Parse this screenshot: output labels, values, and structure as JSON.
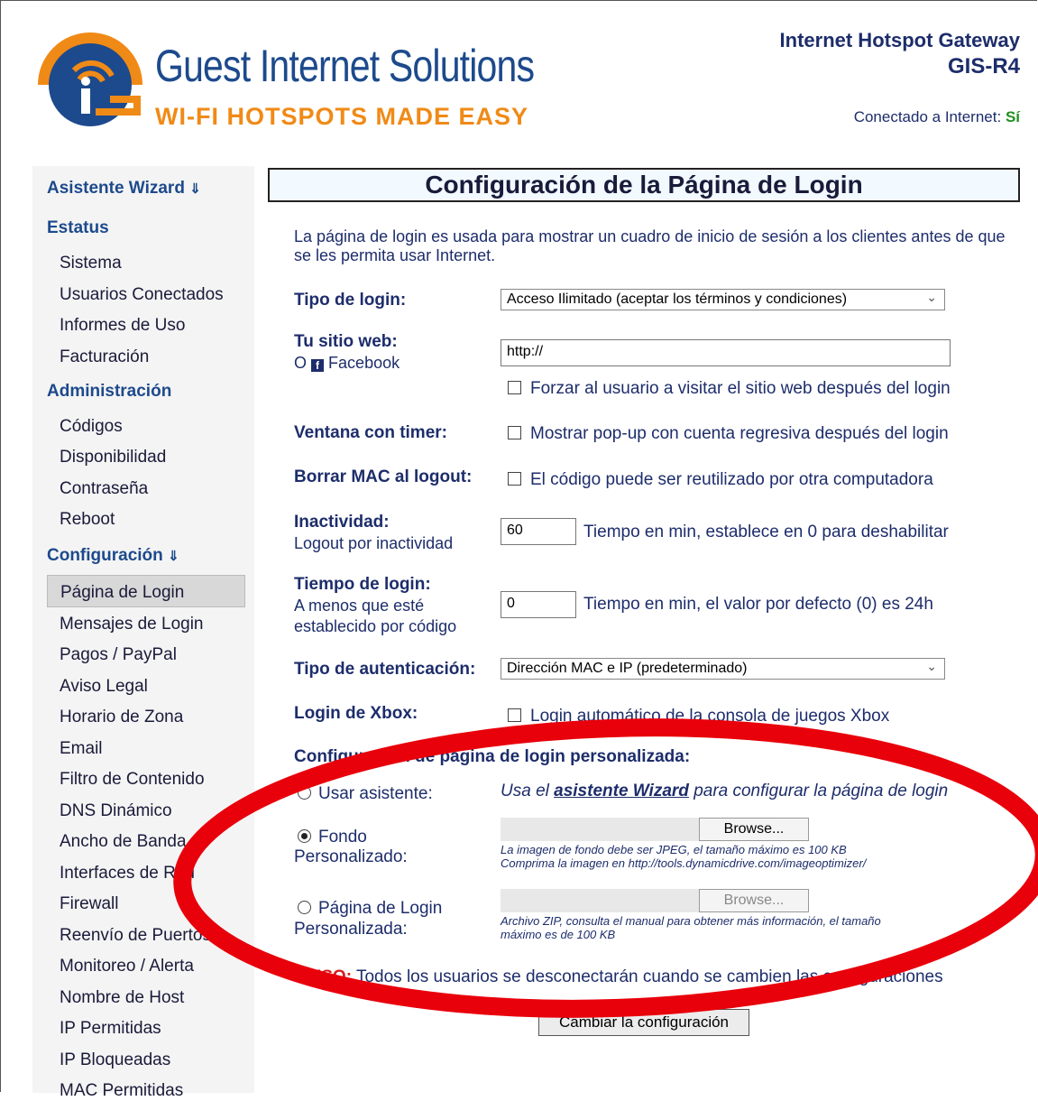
{
  "header": {
    "brand": "Guest Internet Solutions",
    "tagline": "WI-FI HOTSPOTS MADE EASY",
    "product_name": "Internet Hotspot Gateway",
    "product_model": "GIS-R4",
    "connection_label": "Conectado a Internet:",
    "connection_value": "Sí"
  },
  "sidebar": {
    "wizard": "Asistente Wizard",
    "estatus": "Estatus",
    "estatus_items": [
      "Sistema",
      "Usuarios Conectados",
      "Informes de Uso",
      "Facturación"
    ],
    "admin": "Administración",
    "admin_items": [
      "Códigos",
      "Disponibilidad",
      "Contraseña",
      "Reboot"
    ],
    "config": "Configuración",
    "config_items": [
      "Página de Login",
      "Mensajes de Login",
      "Pagos / PayPal",
      "Aviso Legal",
      "Horario de Zona",
      "Email",
      "Filtro de Contenido",
      "DNS Dinámico",
      "Ancho de Banda",
      "Interfaces de Red",
      "Firewall",
      "Reenvío de Puertos",
      "Monitoreo / Alerta",
      "Nombre de Host",
      "IP Permitidas",
      "IP Bloqueadas",
      "MAC Permitidas"
    ],
    "accent_color": "#1d4a8c"
  },
  "main": {
    "title": "Configuración de la Página de Login",
    "intro": "La página de login es usada para mostrar un cuadro de inicio de sesión a los clientes antes de que se les permita usar Internet.",
    "login_type_label": "Tipo de login:",
    "login_type_value": "Acceso Ilimitado (aceptar los términos y condiciones)",
    "website_label": "Tu sitio web:",
    "website_or": "O",
    "website_facebook": "Facebook",
    "website_value": "http://",
    "force_visit": "Forzar al usuario a visitar el sitio web después del login",
    "timer_label": "Ventana con timer:",
    "timer_option": "Mostrar pop-up con cuenta regresiva después del login",
    "mac_label": "Borrar MAC al logout:",
    "mac_option": "El código puede ser reutilizado por otra computadora",
    "inactivity_label": "Inactividad:",
    "inactivity_sub": "Logout por inactividad",
    "inactivity_value": "60",
    "inactivity_hint": "Tiempo en min, establece en 0 para deshabilitar",
    "login_time_label": "Tiempo de login:",
    "login_time_sub1": "A menos que esté",
    "login_time_sub2": "establecido por código",
    "login_time_value": "0",
    "login_time_hint": "Tiempo en min, el valor por defecto (0) es 24h",
    "auth_label": "Tipo de autenticación:",
    "auth_value": "Dirección MAC e IP (predeterminado)",
    "xbox_label": "Login de Xbox:",
    "xbox_option": "Login automático de la consola de juegos Xbox",
    "custom_heading": "Configuración de página de login personalizada:",
    "use_wizard": "Usar asistente:",
    "wizard_text_pre": "Usa el",
    "wizard_link": "asistente Wizard",
    "wizard_text_post": "para configurar la página de login",
    "bg_label1": "Fondo",
    "bg_label2": "Personalizado:",
    "browse": "Browse...",
    "bg_hint1": "La imagen de fondo debe ser JPEG, el tamaño máximo es 100 KB",
    "bg_hint2": "Comprima la imagen en http://tools.dynamicdrive.com/imageoptimizer/",
    "page_label1": "Página de Login",
    "page_label2": "Personalizada:",
    "page_hint1": "Archivo ZIP, consulta el manual para obtener más información, el tamaño",
    "page_hint2": "máximo es de 100 KB",
    "warn_label": "AVISO:",
    "warn_text": "Todos los usuarios se desconectarán cuando se cambien las configuraciones",
    "submit": "Cambiar la configuración"
  }
}
